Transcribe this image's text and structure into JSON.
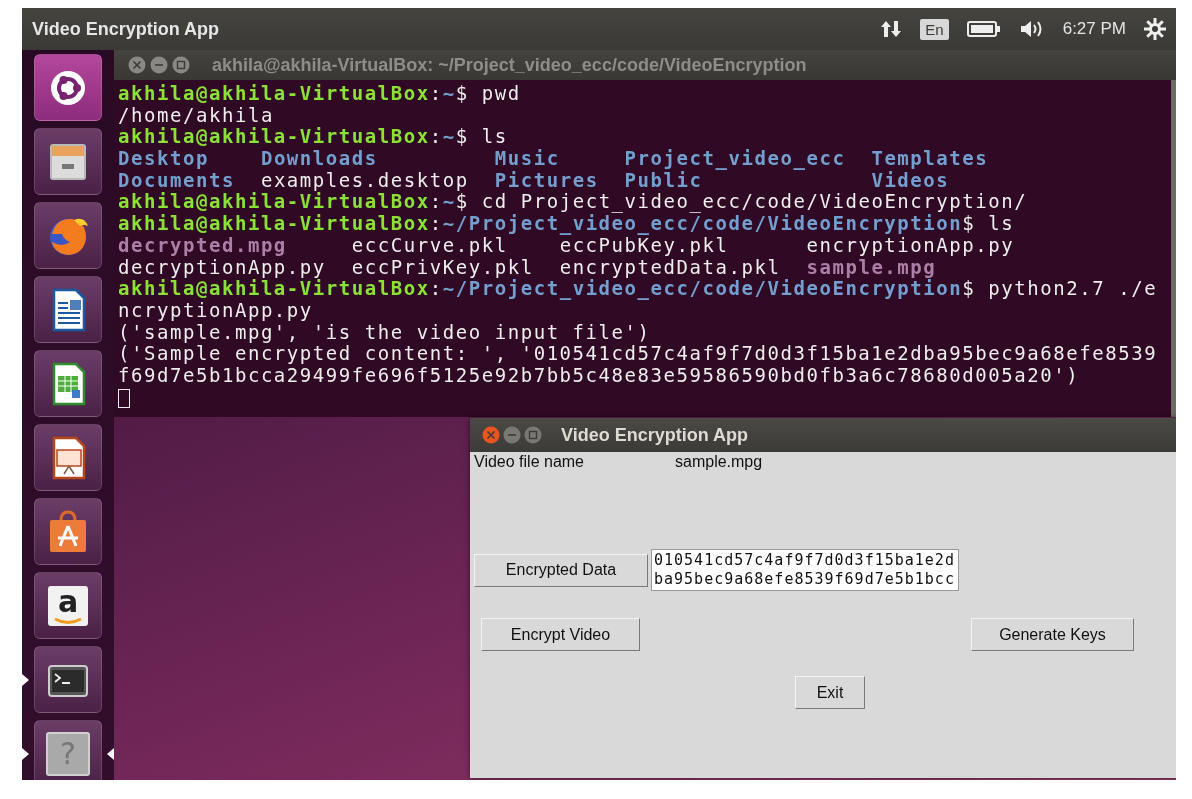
{
  "top_panel": {
    "title": "Video Encryption App",
    "keyboard_layout": "En",
    "clock": "6:27 PM"
  },
  "launcher": [
    {
      "kind": "dash",
      "running": false,
      "focused": false
    },
    {
      "kind": "files",
      "running": false,
      "focused": false
    },
    {
      "kind": "browser",
      "running": false,
      "focused": false
    },
    {
      "kind": "writer",
      "running": false,
      "focused": false
    },
    {
      "kind": "calc",
      "running": false,
      "focused": false
    },
    {
      "kind": "impress",
      "running": false,
      "focused": false
    },
    {
      "kind": "software",
      "running": false,
      "focused": false
    },
    {
      "kind": "store",
      "glyph": "a",
      "running": false,
      "focused": false
    },
    {
      "kind": "terminal",
      "running": true,
      "focused": false
    },
    {
      "kind": "help",
      "glyph": "?",
      "running": true,
      "focused": true
    }
  ],
  "terminal": {
    "title": "akhila@akhila-VirtualBox: ~/Project_video_ecc/code/VideoEncryption",
    "lines": [
      [
        {
          "kind": "user",
          "text": "akhila@akhila-VirtualBox"
        },
        {
          "kind": "plain",
          "text": ":"
        },
        {
          "kind": "path",
          "text": "~"
        },
        {
          "kind": "plain",
          "text": "$ pwd"
        }
      ],
      [
        {
          "kind": "plain",
          "text": "/home/akhila"
        }
      ],
      [
        {
          "kind": "user",
          "text": "akhila@akhila-VirtualBox"
        },
        {
          "kind": "plain",
          "text": ":"
        },
        {
          "kind": "path",
          "text": "~"
        },
        {
          "kind": "plain",
          "text": "$ ls"
        }
      ],
      [
        {
          "kind": "dir",
          "text": "Desktop    "
        },
        {
          "kind": "dir",
          "text": "Downloads         "
        },
        {
          "kind": "dir",
          "text": "Music     "
        },
        {
          "kind": "dir",
          "text": "Project_video_ecc  "
        },
        {
          "kind": "dir",
          "text": "Templates"
        }
      ],
      [
        {
          "kind": "dir",
          "text": "Documents  "
        },
        {
          "kind": "plain",
          "text": "examples.desktop  "
        },
        {
          "kind": "dir",
          "text": "Pictures  "
        },
        {
          "kind": "dir",
          "text": "Public             "
        },
        {
          "kind": "dir",
          "text": "Videos"
        }
      ],
      [
        {
          "kind": "user",
          "text": "akhila@akhila-VirtualBox"
        },
        {
          "kind": "plain",
          "text": ":"
        },
        {
          "kind": "path",
          "text": "~"
        },
        {
          "kind": "plain",
          "text": "$ cd Project_video_ecc/code/VideoEncryption/"
        }
      ],
      [
        {
          "kind": "user",
          "text": "akhila@akhila-VirtualBox"
        },
        {
          "kind": "plain",
          "text": ":"
        },
        {
          "kind": "path",
          "text": "~/Project_video_ecc/code/VideoEncryption"
        },
        {
          "kind": "plain",
          "text": "$ ls"
        }
      ],
      [
        {
          "kind": "media",
          "text": "decrypted.mpg     "
        },
        {
          "kind": "plain",
          "text": "eccCurve.pkl    "
        },
        {
          "kind": "plain",
          "text": "eccPubKey.pkl      "
        },
        {
          "kind": "plain",
          "text": "encryptionApp.py"
        }
      ],
      [
        {
          "kind": "plain",
          "text": "decryptionApp.py  "
        },
        {
          "kind": "plain",
          "text": "eccPrivKey.pkl  "
        },
        {
          "kind": "plain",
          "text": "encryptedData.pkl  "
        },
        {
          "kind": "media",
          "text": "sample.mpg"
        }
      ],
      [
        {
          "kind": "user",
          "text": "akhila@akhila-VirtualBox"
        },
        {
          "kind": "plain",
          "text": ":"
        },
        {
          "kind": "path",
          "text": "~/Project_video_ecc/code/VideoEncryption"
        },
        {
          "kind": "plain",
          "text": "$ python2.7 ./e"
        }
      ],
      [
        {
          "kind": "plain",
          "text": "ncryptionApp.py"
        }
      ],
      [
        {
          "kind": "plain",
          "text": "('sample.mpg', 'is the video input file')"
        }
      ],
      [
        {
          "kind": "plain",
          "text": "('Sample encrypted content: ', '010541cd57c4af9f7d0d3f15ba1e2dba95bec9a68efe8539"
        }
      ],
      [
        {
          "kind": "plain",
          "text": "f69d7e5b1bcca29499fe696f5125e92b7bb5c48e83e59586590bd0fb3a6c78680d005a20')"
        }
      ]
    ]
  },
  "dialog": {
    "title": "Video Encryption App",
    "file_label": "Video file name",
    "file_value": "sample.mpg",
    "encrypted_data_button": "Encrypted Data",
    "encrypted_data_lines": [
      "010541cd57c4af9f7d0d3f15ba1e2d",
      "ba95bec9a68efe8539f69d7e5b1bcc"
    ],
    "encrypt_button": "Encrypt Video",
    "generate_button": "Generate Keys",
    "exit_button": "Exit"
  }
}
